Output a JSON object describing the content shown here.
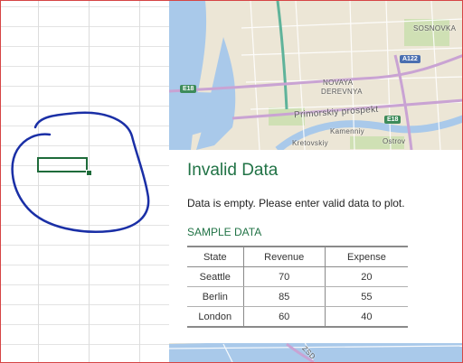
{
  "map": {
    "labels": [
      "SOSNOVKA",
      "NOVAYA",
      "DEREVNYA",
      "Primorskiy prospekt",
      "Kamenniy",
      "Kretovskiy",
      "Ostrov",
      "ZSD"
    ],
    "shields": [
      "E18",
      "A122",
      "E18"
    ],
    "colors": {
      "land": "#ece6d6",
      "water": "#a9c9ea",
      "highway": "#c9a3d3",
      "green": "#cfe0b4"
    }
  },
  "card": {
    "title": "Invalid Data",
    "message": "Data is empty. Please enter valid data to plot.",
    "sample_heading": "SAMPLE DATA",
    "table": {
      "headers": [
        "State",
        "Revenue",
        "Expense"
      ],
      "rows": [
        [
          "Seattle",
          "70",
          "20"
        ],
        [
          "Berlin",
          "85",
          "55"
        ],
        [
          "London",
          "60",
          "40"
        ]
      ]
    }
  },
  "colors": {
    "accent": "#217346",
    "ink": "#1a2fa6",
    "cell_selection": "#1e6b3a"
  }
}
